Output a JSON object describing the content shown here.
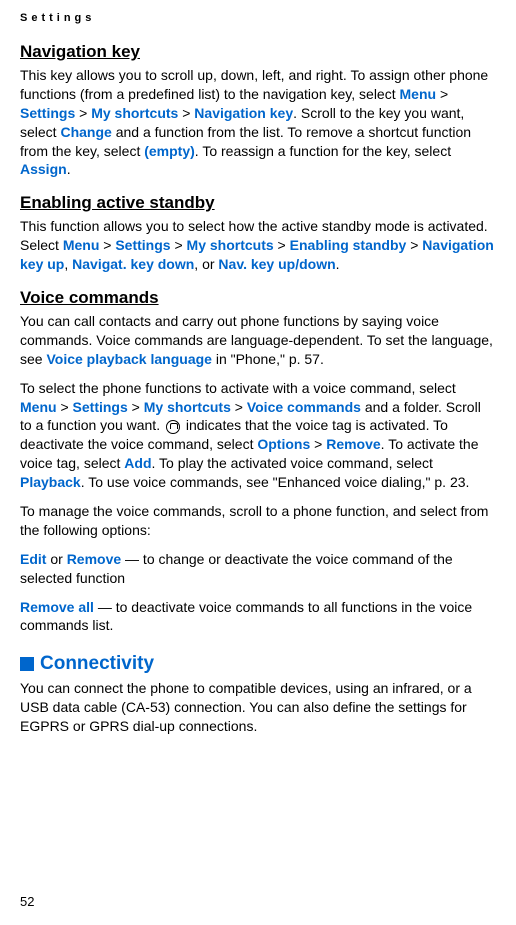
{
  "header": "Settings",
  "pageNumber": "52",
  "sections": {
    "navKey": {
      "heading": "Navigation key",
      "p1_pre": "This key allows you to scroll up, down, left, and right. To assign other phone functions (from a predefined list) to the navigation key, select ",
      "menu": "Menu",
      "gt1": " > ",
      "settings": "Settings",
      "gt2": " > ",
      "myshortcuts": "My shortcuts",
      "gt3": " > ",
      "navkey": "Navigation key",
      "p1_mid1": ". Scroll to the key you want, select ",
      "change": "Change",
      "p1_mid2": " and a function from the list. To remove a shortcut function from the key, select ",
      "empty": "(empty)",
      "p1_mid3": ". To reassign a function for the key, select ",
      "assign": "Assign",
      "p1_end": "."
    },
    "standby": {
      "heading": "Enabling active standby",
      "p1_pre": "This function allows you to select how the active standby mode is activated. Select ",
      "menu": "Menu",
      "gt1": " > ",
      "settings": "Settings",
      "gt2": " > ",
      "myshortcuts": "My shortcuts",
      "gt3": " > ",
      "enabling": "Enabling standby",
      "gt4": " > ",
      "navkeyup": "Navigation key up",
      "comma1": ", ",
      "navkeydown": "Navigat. key down",
      "comma2": ", or ",
      "navkeyupdown": "Nav. key up/down",
      "p1_end": "."
    },
    "voice": {
      "heading": "Voice commands",
      "p1_pre": "You can call contacts and carry out phone functions by saying voice commands. Voice commands are language-dependent. To set the language, see ",
      "voicelang": "Voice playback language",
      "p1_end": " in \"Phone,\" p. 57.",
      "p2_pre": "To select the phone functions to activate with a voice command, select ",
      "menu": "Menu",
      "gt1": " > ",
      "settings": "Settings",
      "gt2": " > ",
      "myshortcuts": "My shortcuts",
      "gt3": " > ",
      "voicecmd": "Voice commands",
      "p2_mid1": " and a folder. Scroll to a function you want. ",
      "p2_mid2": " indicates that the voice tag is activated. To deactivate the voice command, select ",
      "options": "Options",
      "gt4": " > ",
      "remove": "Remove",
      "p2_mid3": ". To activate the voice tag, select ",
      "add": "Add",
      "p2_mid4": ". To play the activated voice command, select ",
      "playback": "Playback",
      "p2_end": ". To use voice commands, see \"Enhanced voice dialing,\" p. 23.",
      "p3": "To manage the voice commands, scroll to a phone function, and select from the following options:",
      "p4_edit": "Edit",
      "p4_or": " or ",
      "p4_remove": "Remove",
      "p4_rest": " — to change or deactivate the voice command of the selected function",
      "p5_removeall": "Remove all",
      "p5_rest": " — to deactivate voice commands to all functions in the voice commands list."
    },
    "connectivity": {
      "heading": "Connectivity",
      "p1": "You can connect the phone to compatible devices, using an infrared, or a USB data cable (CA-53) connection. You can also define the settings for EGPRS or GPRS dial-up connections."
    }
  }
}
